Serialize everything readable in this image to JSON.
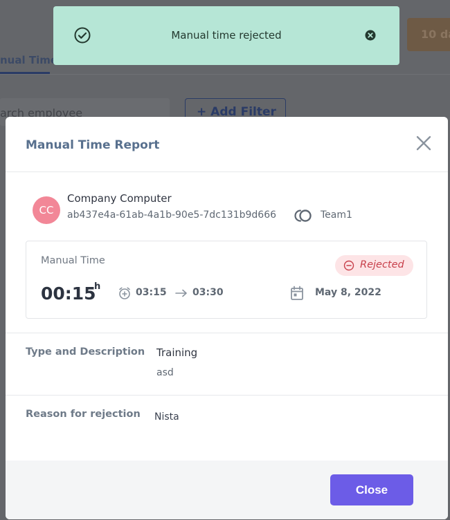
{
  "background": {
    "tab_label": "nual Time",
    "search_placeholder": "arch employee",
    "filter_label": "+ Add Filter",
    "days_label": "10 da"
  },
  "toast": {
    "message": "Manual time rejected",
    "icon": "check-circle-icon",
    "close_icon": "close-circle-icon",
    "color": "#b6e6d6"
  },
  "modal": {
    "title": "Manual Time Report",
    "employee": {
      "initials": "CC",
      "name": "Company Computer",
      "id": "ab437e4a-61ab-4a1b-90e5-7dc131b9d666",
      "avatar_color": "#f28797"
    },
    "team": {
      "name": "Team1",
      "icon": "team-icon"
    },
    "entry": {
      "label": "Manual Time",
      "status": "Rejected",
      "status_color": "#c8404b",
      "duration": "00:15",
      "duration_unit": "h",
      "start": "03:15",
      "end": "03:30",
      "date": "May 8, 2022"
    },
    "details": {
      "type_label": "Type and Description",
      "type_value": "Training",
      "description": "asd",
      "reason_label": "Reason for rejection",
      "reason_value": "Nista"
    },
    "close_label": "Close",
    "accent": "#6c5ce7"
  }
}
